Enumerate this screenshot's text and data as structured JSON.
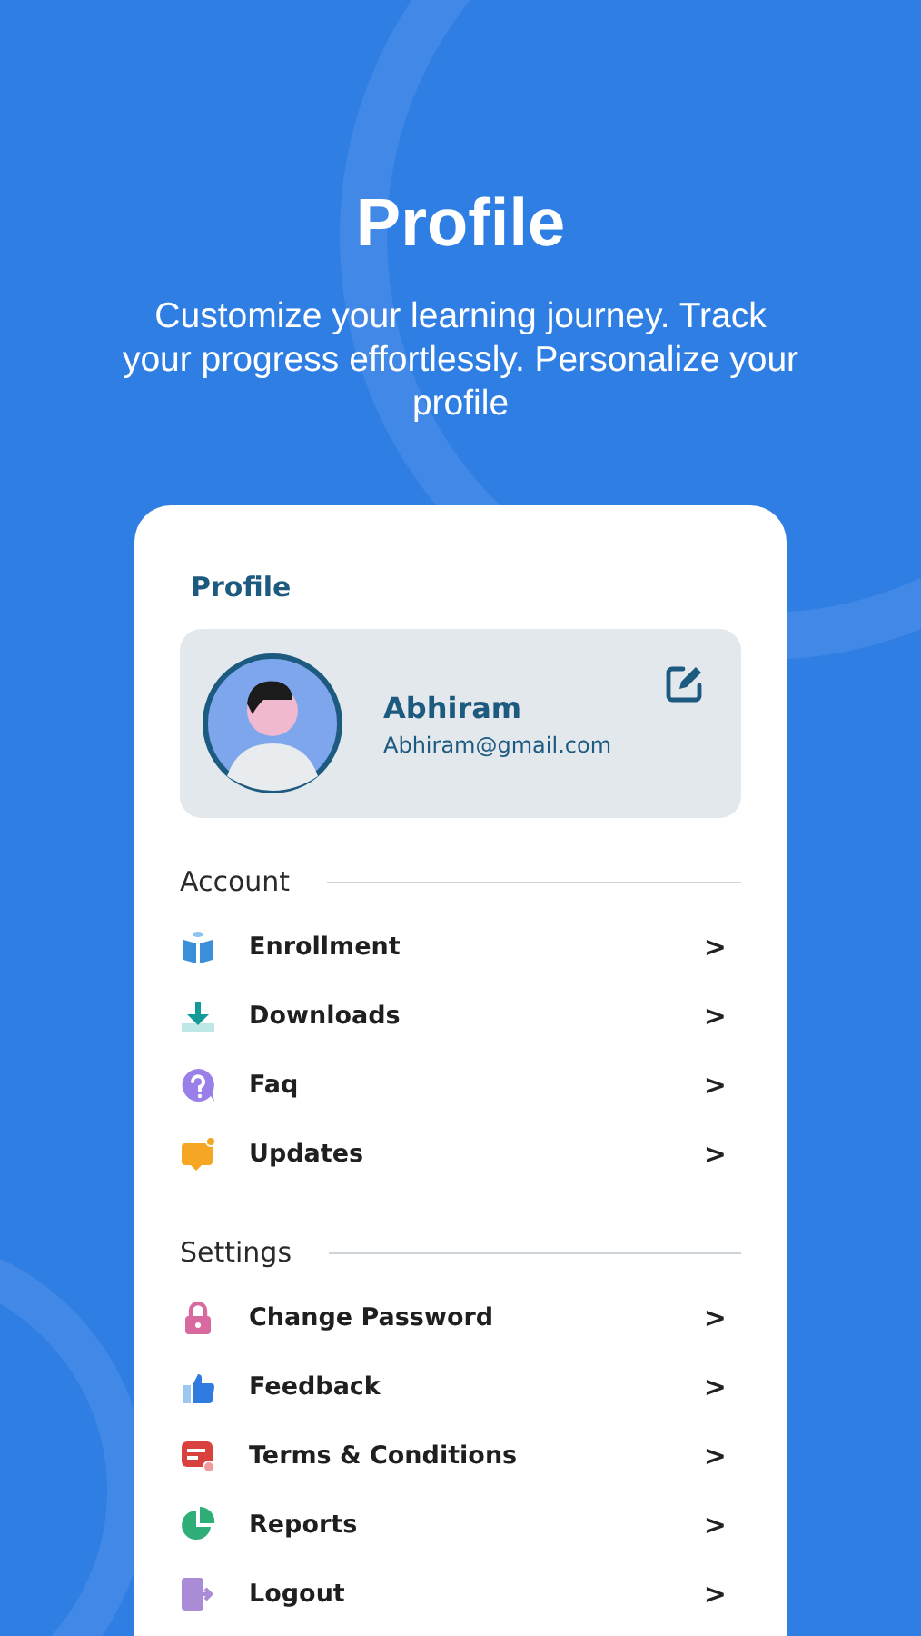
{
  "header": {
    "title": "Profile",
    "subtitle": "Customize your learning journey. Track your progress effortlessly. Personalize your profile"
  },
  "card": {
    "title": "Profile",
    "user": {
      "name": "Abhiram",
      "email": "Abhiram@gmail.com"
    },
    "sections": [
      {
        "heading": "Account",
        "items": [
          {
            "label": "Enrollment",
            "chevron": ">"
          },
          {
            "label": "Downloads",
            "chevron": ">"
          },
          {
            "label": "Faq",
            "chevron": ">"
          },
          {
            "label": "Updates",
            "chevron": ">"
          }
        ]
      },
      {
        "heading": "Settings",
        "items": [
          {
            "label": "Change Password",
            "chevron": ">"
          },
          {
            "label": "Feedback",
            "chevron": ">"
          },
          {
            "label": "Terms & Conditions",
            "chevron": ">"
          },
          {
            "label": "Reports",
            "chevron": ">"
          },
          {
            "label": "Logout",
            "chevron": ">"
          }
        ]
      }
    ]
  }
}
